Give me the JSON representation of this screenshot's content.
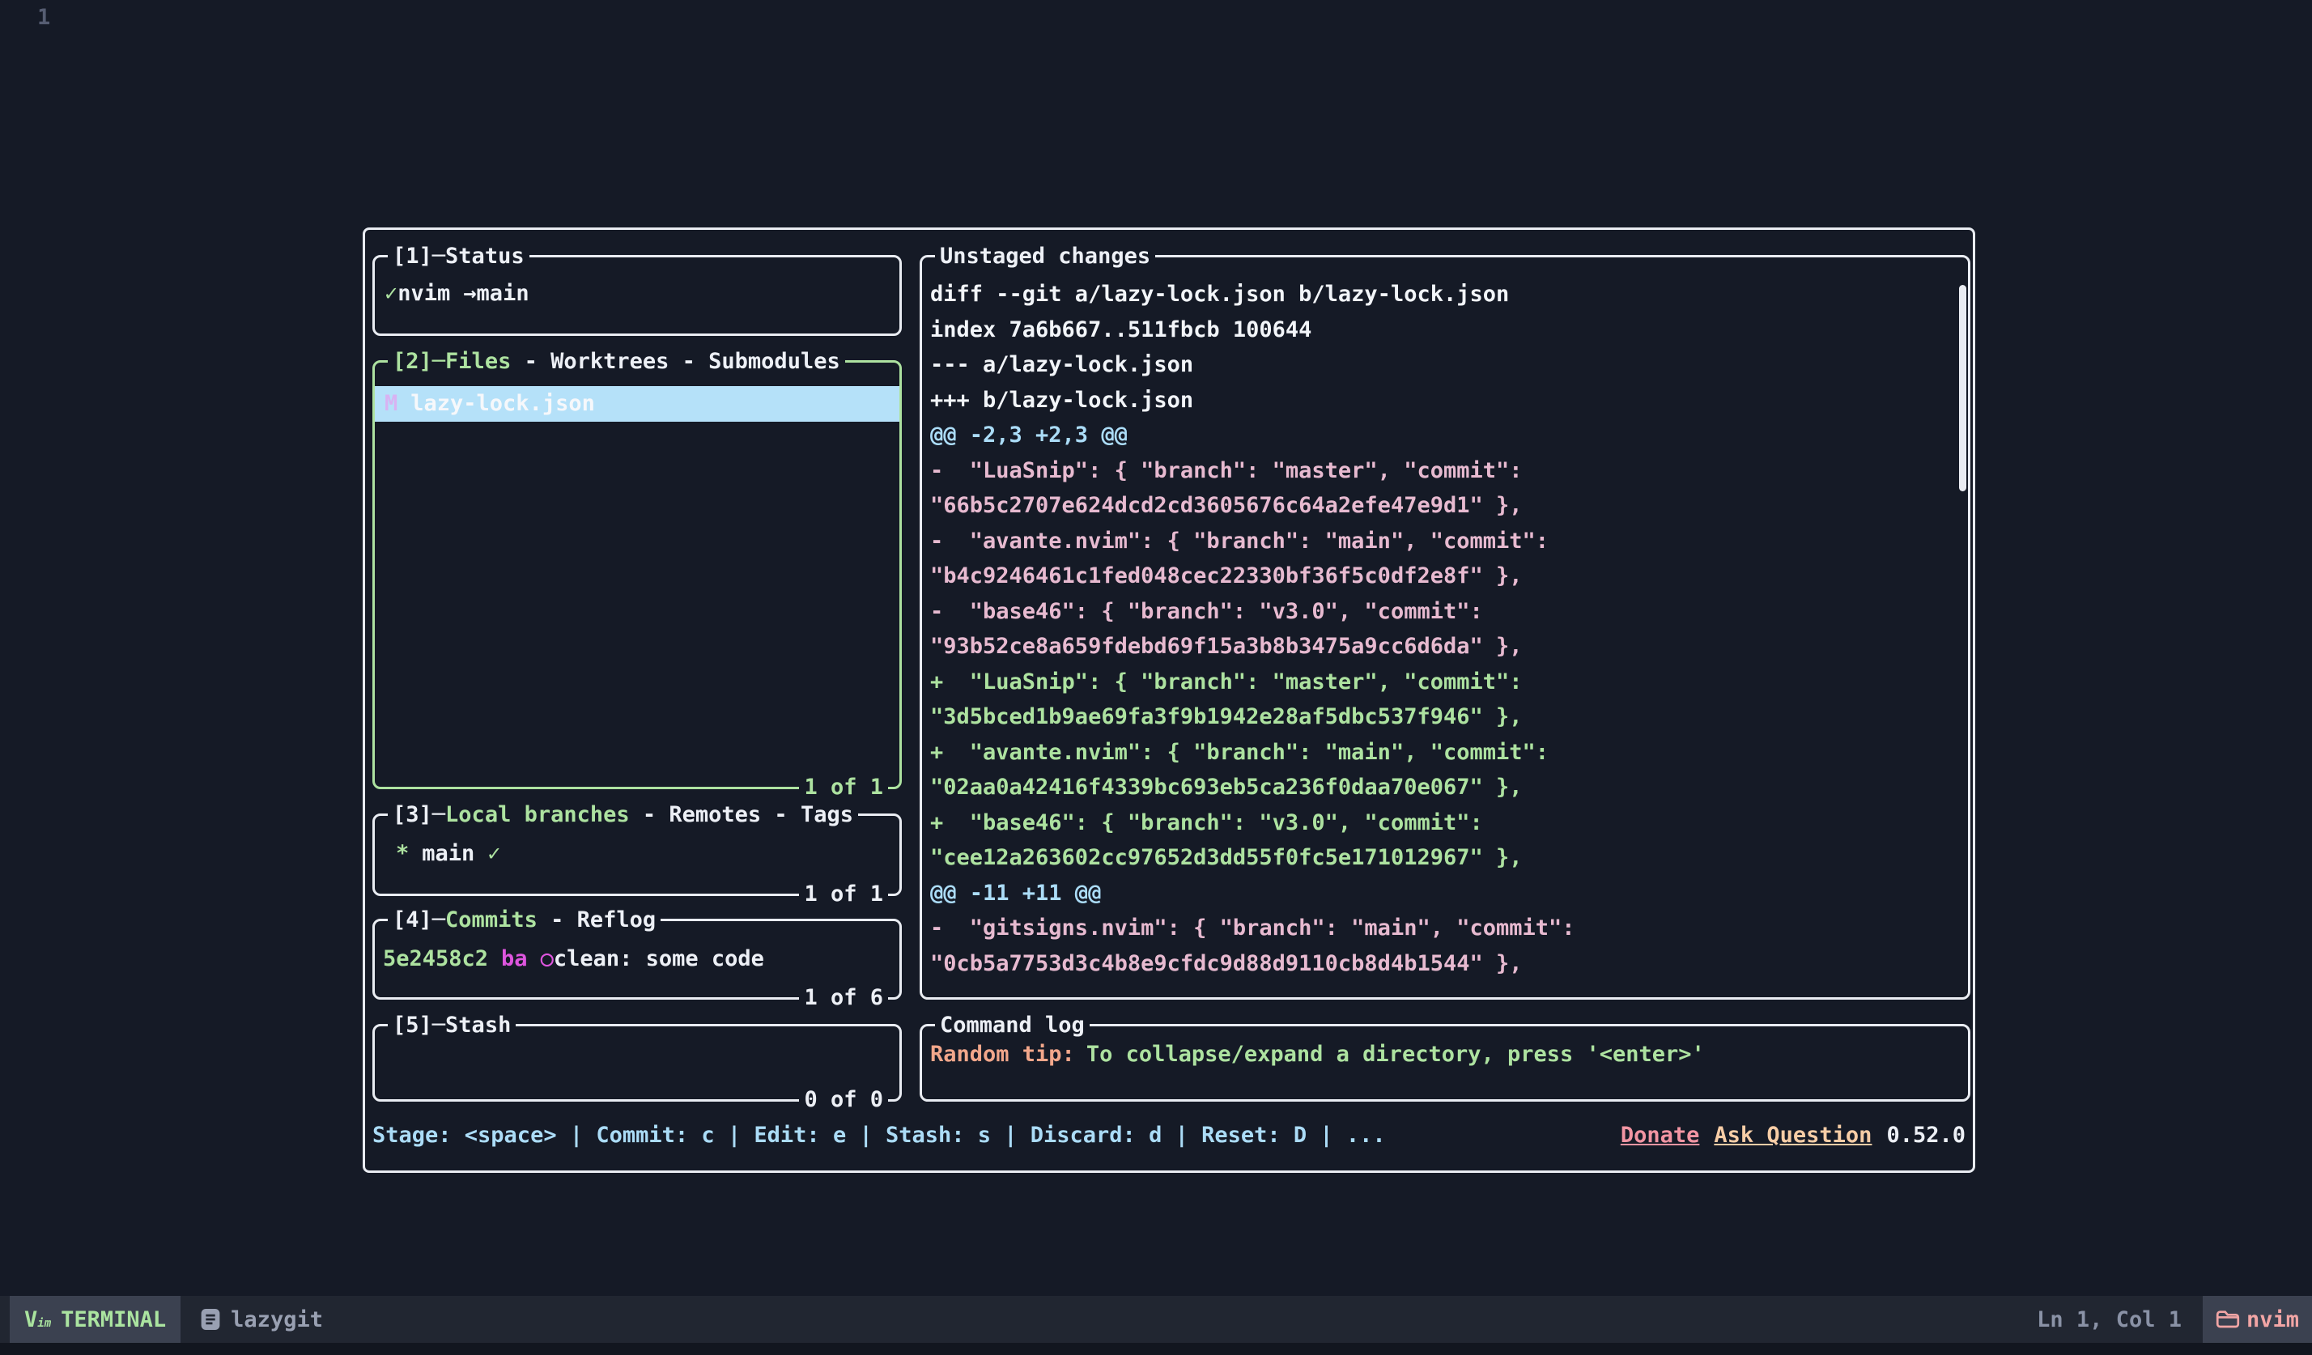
{
  "colors": {
    "background": "#151a26",
    "panel_border": "#e9ecf2",
    "active_panel_border": "#ade2a0",
    "green": "#ade2a0",
    "cyan": "#abdcf7",
    "diff_delete": "#e7bad0",
    "magenta": "#de55de",
    "file_status_violet": "#d8b2f2",
    "selected_row_bg": "#b5e1f9",
    "salmon": "#f2a78b",
    "link_pink": "#f295a3",
    "link_peach": "#f7cda6",
    "statusline_green": "#abe4a0",
    "statusline_pink": "#f2a5a5"
  },
  "editor": {
    "line_number": "1",
    "statusline": {
      "mode_label": "TERMINAL",
      "filename": "lazygit",
      "position": "Ln 1, Col 1",
      "app_label": "nvim"
    }
  },
  "lazygit": {
    "ui": {
      "title_sep": "─"
    },
    "status_panel": {
      "number": "[1]",
      "title": "Status",
      "check": "✓",
      "repo": "nvim",
      "branch": "→main"
    },
    "files_panel": {
      "number": "[2]",
      "tab": "Files",
      "tabs_rest": " - Worktrees - Submodules",
      "file_status": "M",
      "file_name": "lazy-lock.json",
      "count": "1 of 1"
    },
    "branches_panel": {
      "number": "[3]",
      "tab": "Local branches",
      "tabs_rest": " - Remotes - Tags",
      "marker": "*",
      "branch": "main",
      "check": "✓",
      "count": "1 of 1"
    },
    "commits_panel": {
      "number": "[4]",
      "tab": "Commits",
      "tabs_rest": " - Reflog",
      "hash": "5e2458c2",
      "author": "ba",
      "bullet": "○",
      "message": "clean: some code",
      "count": "1 of 6"
    },
    "stash_panel": {
      "number": "[5]",
      "title": "Stash",
      "count": "0 of 0"
    },
    "main_panel": {
      "title": "Unstaged changes",
      "lines": [
        {
          "kind": "header",
          "text": "diff --git a/lazy-lock.json b/lazy-lock.json"
        },
        {
          "kind": "header",
          "text": "index 7a6b667..511fbcb 100644"
        },
        {
          "kind": "header",
          "text": "--- a/lazy-lock.json"
        },
        {
          "kind": "header",
          "text": "+++ b/lazy-lock.json"
        },
        {
          "kind": "hunk",
          "text": "@@ -2,3 +2,3 @@"
        },
        {
          "kind": "del",
          "text": "-  \"LuaSnip\": { \"branch\": \"master\", \"commit\":"
        },
        {
          "kind": "del",
          "text": "\"66b5c2707e624dcd2cd3605676c64a2efe47e9d1\" },"
        },
        {
          "kind": "del",
          "text": "-  \"avante.nvim\": { \"branch\": \"main\", \"commit\":"
        },
        {
          "kind": "del",
          "text": "\"b4c9246461c1fed048cec22330bf36f5c0df2e8f\" },"
        },
        {
          "kind": "del",
          "text": "-  \"base46\": { \"branch\": \"v3.0\", \"commit\":"
        },
        {
          "kind": "del",
          "text": "\"93b52ce8a659fdebd69f15a3b8b3475a9cc6d6da\" },"
        },
        {
          "kind": "add",
          "text": "+  \"LuaSnip\": { \"branch\": \"master\", \"commit\":"
        },
        {
          "kind": "add",
          "text": "\"3d5bced1b9ae69fa3f9b1942e28af5dbc537f946\" },"
        },
        {
          "kind": "add",
          "text": "+  \"avante.nvim\": { \"branch\": \"main\", \"commit\":"
        },
        {
          "kind": "add",
          "text": "\"02aa0a42416f4339bc693eb5ca236f0daa70e067\" },"
        },
        {
          "kind": "add",
          "text": "+  \"base46\": { \"branch\": \"v3.0\", \"commit\":"
        },
        {
          "kind": "add",
          "text": "\"cee12a263602cc97652d3dd55f0fc5e171012967\" },"
        },
        {
          "kind": "hunk",
          "text": "@@ -11 +11 @@"
        },
        {
          "kind": "del",
          "text": "-  \"gitsigns.nvim\": { \"branch\": \"main\", \"commit\":"
        },
        {
          "kind": "del",
          "text": "\"0cb5a7753d3c4b8e9cfdc9d88d9110cb8d4b1544\" },"
        }
      ]
    },
    "command_log_panel": {
      "title": "Command log",
      "tip_label": "Random tip:",
      "tip_text": "To collapse/expand a directory, press '<enter>'"
    },
    "keybar": {
      "hints": "Stage: <space> | Commit: c | Edit: e | Stash: s | Discard: d | Reset: D | ...",
      "donate": "Donate",
      "ask_question": "Ask Question",
      "version": "0.52.0"
    }
  }
}
